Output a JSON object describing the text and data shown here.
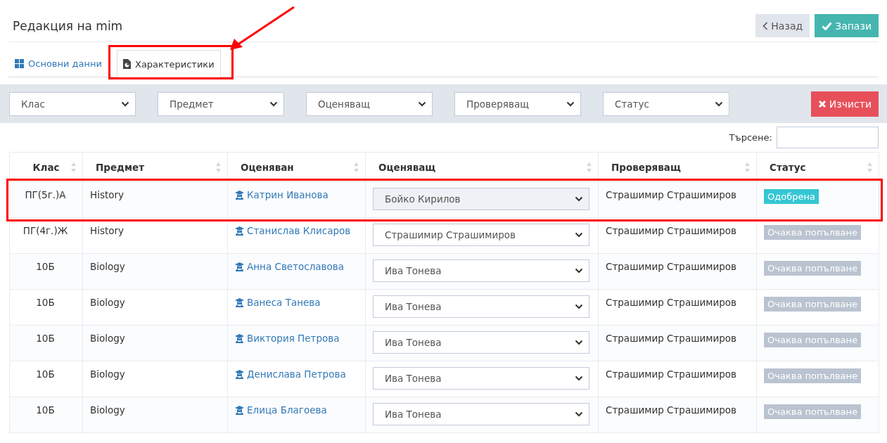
{
  "page": {
    "title": "Редакция на mim"
  },
  "actions": {
    "back": "Назад",
    "save": "Запази"
  },
  "tabs": [
    {
      "label": "Основни данни",
      "selected": false
    },
    {
      "label": "Характеристики",
      "selected": true
    }
  ],
  "filters": {
    "selects": [
      "Клас",
      "Предмет",
      "Оценяващ",
      "Проверяващ",
      "Статус"
    ],
    "clear": "Изчисти"
  },
  "search": {
    "label": "Търсене:"
  },
  "table": {
    "columns": [
      "Клас",
      "Предмет",
      "Оценяван",
      "Оценяващ",
      "Проверяващ",
      "Статус"
    ],
    "rows": [
      {
        "class": "ПГ(5г.)А",
        "subject": "History",
        "student": "Катрин Иванова",
        "evaluator": {
          "value": "Бойко Кирилов",
          "disabled": true
        },
        "reviewer": "Страшимир Страшимиров",
        "status": {
          "label": "Одобрена",
          "kind": "approved"
        },
        "highlighted": true
      },
      {
        "class": "ПГ(4г.)Ж",
        "subject": "History",
        "student": "Станислав Клисаров",
        "evaluator": {
          "value": "Страшимир Страшимиров",
          "disabled": false
        },
        "reviewer": "Страшимир Страшимиров",
        "status": {
          "label": "Очаква попълване",
          "kind": "pending"
        },
        "highlighted": false
      },
      {
        "class": "10Б",
        "subject": "Biology",
        "student": "Анна Светославова",
        "evaluator": {
          "value": "Ива Тонева",
          "disabled": false
        },
        "reviewer": "Страшимир Страшимиров",
        "status": {
          "label": "Очаква попълване",
          "kind": "pending"
        },
        "highlighted": false
      },
      {
        "class": "10Б",
        "subject": "Biology",
        "student": "Ванеса Танева",
        "evaluator": {
          "value": "Ива Тонева",
          "disabled": false
        },
        "reviewer": "Страшимир Страшимиров",
        "status": {
          "label": "Очаква попълване",
          "kind": "pending"
        },
        "highlighted": false
      },
      {
        "class": "10Б",
        "subject": "Biology",
        "student": "Виктория Петрова",
        "evaluator": {
          "value": "Ива Тонева",
          "disabled": false
        },
        "reviewer": "Страшимир Страшимиров",
        "status": {
          "label": "Очаква попълване",
          "kind": "pending"
        },
        "highlighted": false
      },
      {
        "class": "10Б",
        "subject": "Biology",
        "student": "Денислава Петрова",
        "evaluator": {
          "value": "Ива Тонева",
          "disabled": false
        },
        "reviewer": "Страшимир Страшимиров",
        "status": {
          "label": "Очаква попълване",
          "kind": "pending"
        },
        "highlighted": false
      },
      {
        "class": "10Б",
        "subject": "Biology",
        "student": "Елица Благоева",
        "evaluator": {
          "value": "Ива Тонева",
          "disabled": false
        },
        "reviewer": "Страшимир Страшимиров",
        "status": {
          "label": "Очаква попълване",
          "kind": "pending"
        },
        "highlighted": false
      }
    ]
  }
}
